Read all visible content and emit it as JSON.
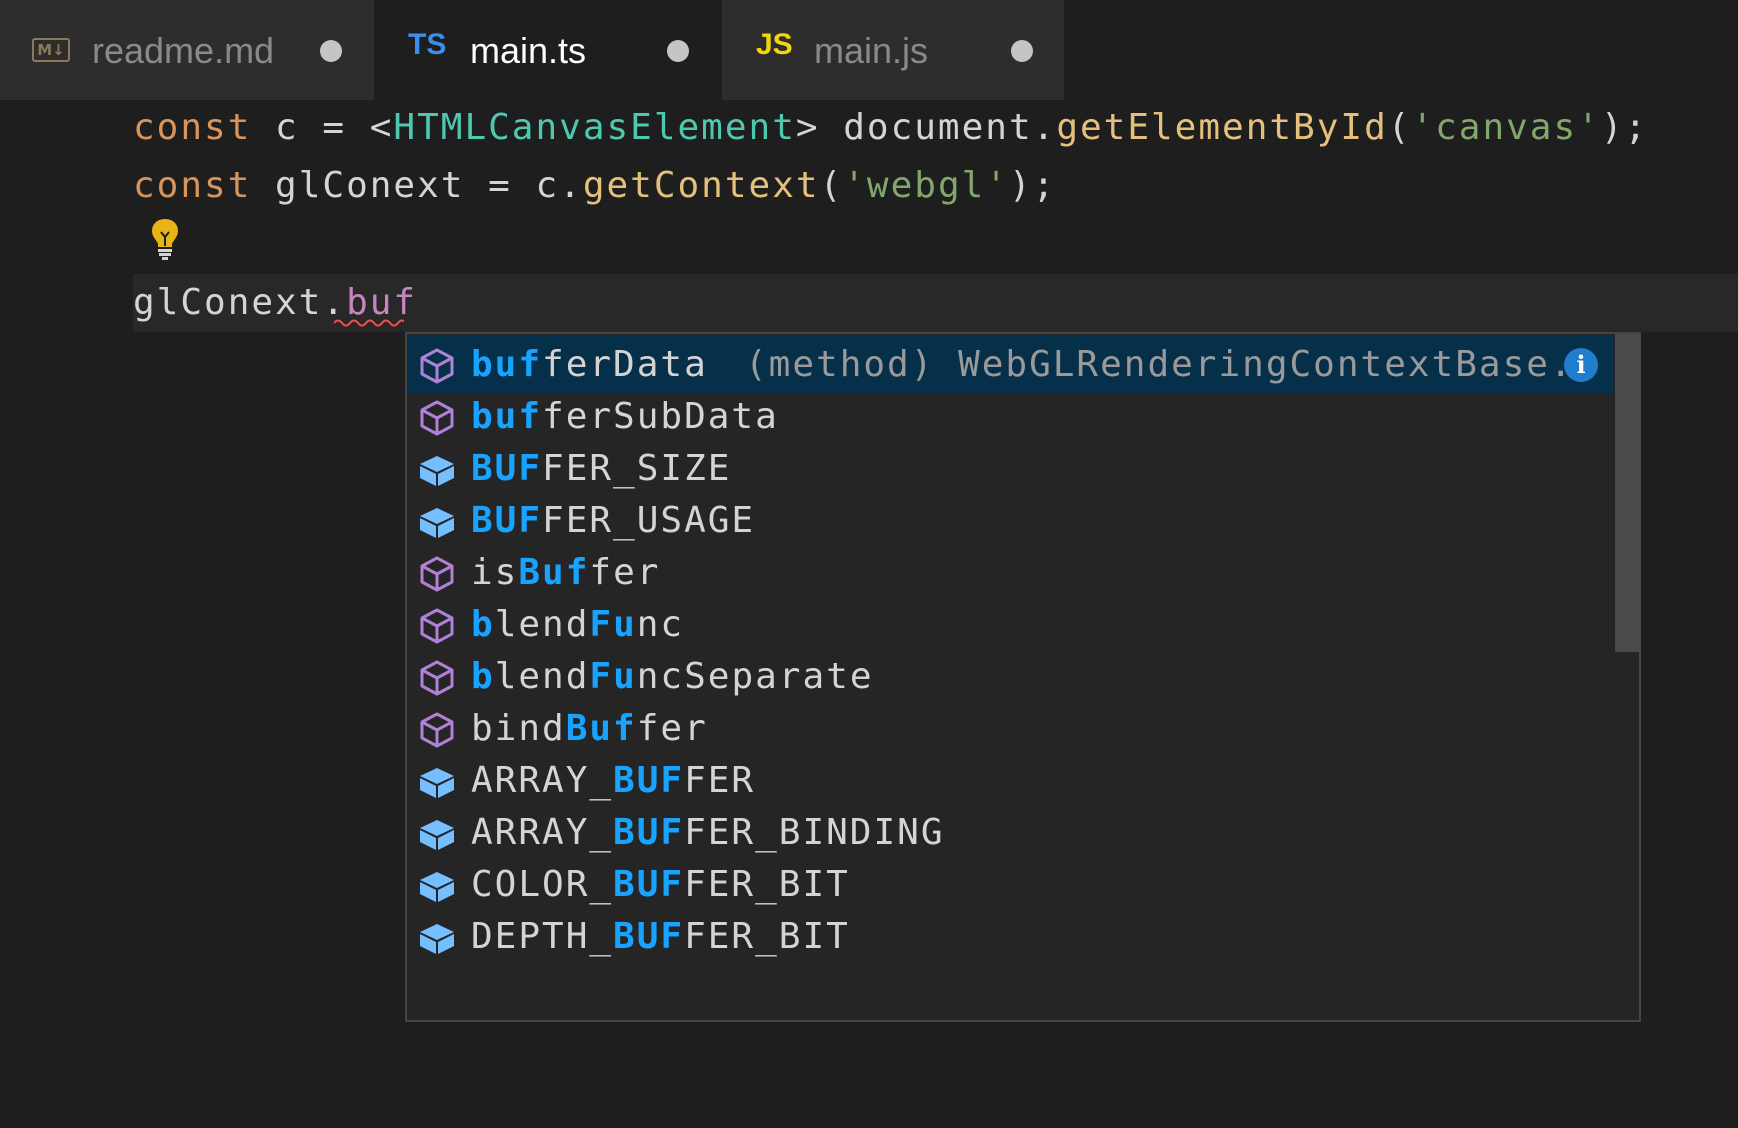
{
  "tabs": [
    {
      "icon": "M↓",
      "label": "readme.md",
      "state": "inactive",
      "modified": true
    },
    {
      "icon": "TS",
      "label": "main.ts",
      "state": "active",
      "modified": true
    },
    {
      "icon": "JS",
      "label": "main.js",
      "state": "inactive",
      "modified": true
    }
  ],
  "colors": {
    "ts_icon": "#3b8eea",
    "js_icon": "#f5d50a",
    "match_highlight": "#18a3ff",
    "selected_item_bg": "#062f4a",
    "method_icon": "#b180d7",
    "field_icon": "#75beff"
  },
  "code": {
    "line1": {
      "kw": "const",
      "var": " c = <",
      "type": "HTMLCanvasElement",
      "mid": "> document.",
      "fn": "getElementById",
      "open": "(",
      "str": "'canvas'",
      "close": ");"
    },
    "line2": {
      "kw": "const",
      "var": " glConext = c.",
      "fn": "getContext",
      "open": "(",
      "str": "'webgl'",
      "close": ");"
    },
    "line4": {
      "obj": "glConext.",
      "partial": "buf"
    }
  },
  "suggestions": [
    {
      "kind": "method-icon",
      "match": "buf",
      "rest": "ferData",
      "pre": "",
      "detail": "(method) WebGLRenderingContextBase.…",
      "selected": true
    },
    {
      "kind": "method-icon",
      "pre": "",
      "match": "buf",
      "rest": "ferSubData"
    },
    {
      "kind": "field-icon",
      "pre": "",
      "match": "BUF",
      "rest": "FER_SIZE"
    },
    {
      "kind": "field-icon",
      "pre": "",
      "match": "BUF",
      "rest": "FER_USAGE"
    },
    {
      "kind": "method-icon",
      "pre": "is",
      "match": "Buf",
      "rest": "fer"
    },
    {
      "kind": "method-icon",
      "pre": "b",
      "match": "lendFu",
      "rest": "nc",
      "mixed": true
    },
    {
      "kind": "method-icon",
      "pre": "b",
      "match": "lendFu",
      "rest": "ncSeparate",
      "mixed": true
    },
    {
      "kind": "method-icon",
      "pre": "bind",
      "match": "Buf",
      "rest": "fer"
    },
    {
      "kind": "field-icon",
      "pre": "ARRAY_",
      "match": "BUF",
      "rest": "FER"
    },
    {
      "kind": "field-icon",
      "pre": "ARRAY_",
      "match": "BUF",
      "rest": "FER_BINDING"
    },
    {
      "kind": "field-icon",
      "pre": "COLOR_",
      "match": "BUF",
      "rest": "FER_BIT"
    },
    {
      "kind": "field-icon",
      "pre": "DEPTH_",
      "match": "BUF",
      "rest": "FER_BIT"
    }
  ],
  "info_icon": "i"
}
